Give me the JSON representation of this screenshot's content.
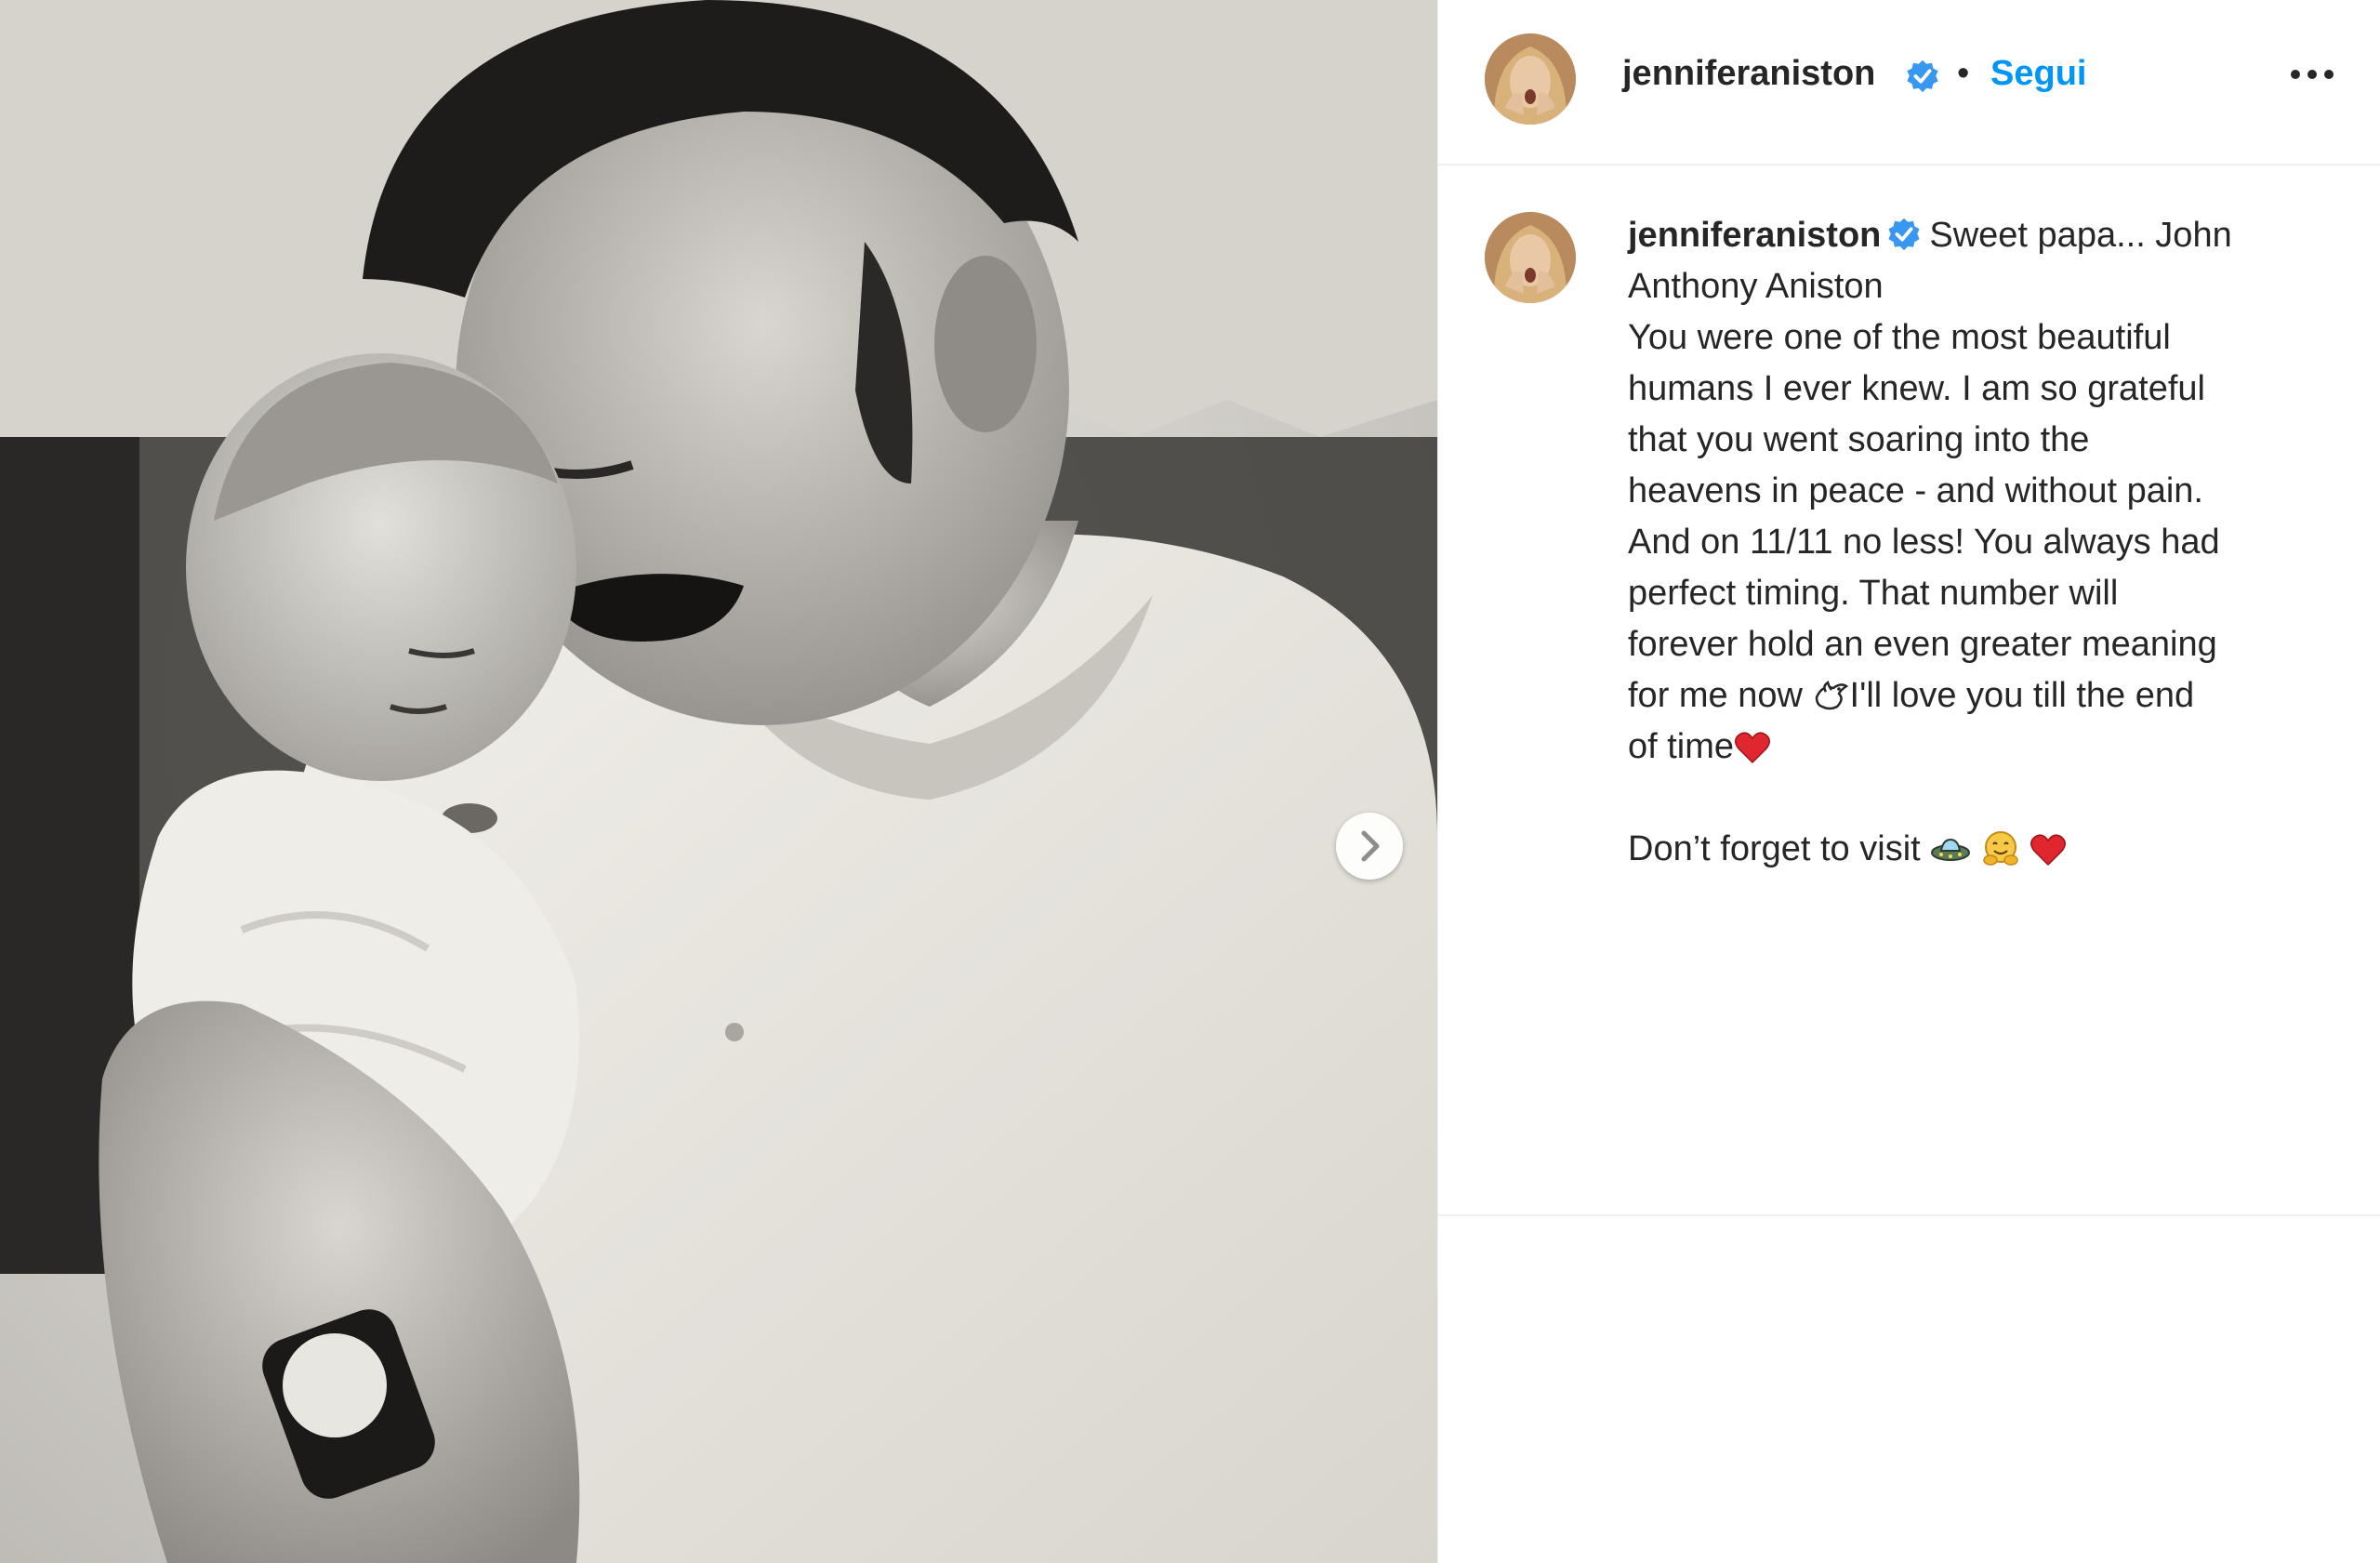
{
  "post": {
    "username": "jenniferaniston",
    "verified": true,
    "separator": "•",
    "follow_label": "Segui",
    "more_icon": "more-horizontal-icon",
    "next_icon": "chevron-right-icon"
  },
  "caption": {
    "username": "jenniferaniston",
    "lines": [
      "Sweet papa... John",
      "Anthony Aniston",
      "You were one of the most beautiful",
      "humans I ever knew. I am so grateful",
      "that you went soaring into the",
      "heavens in peace - and without pain.",
      "And on 11/11 no less! You always had",
      "perfect timing. That number will",
      "forever hold an even greater meaning",
      "for me now",
      "I'll love you till the end",
      "of time",
      "Don’t forget to visit"
    ],
    "emojis": {
      "dove": "dove-emoji",
      "heart": "red-heart-emoji",
      "alien": "flying-saucer-emoji",
      "hug": "hugging-face-emoji"
    }
  },
  "colors": {
    "text": "#262626",
    "link": "#0095f6",
    "verified": "#3897f0",
    "divider": "#efefef",
    "heart": "#e0262f"
  }
}
